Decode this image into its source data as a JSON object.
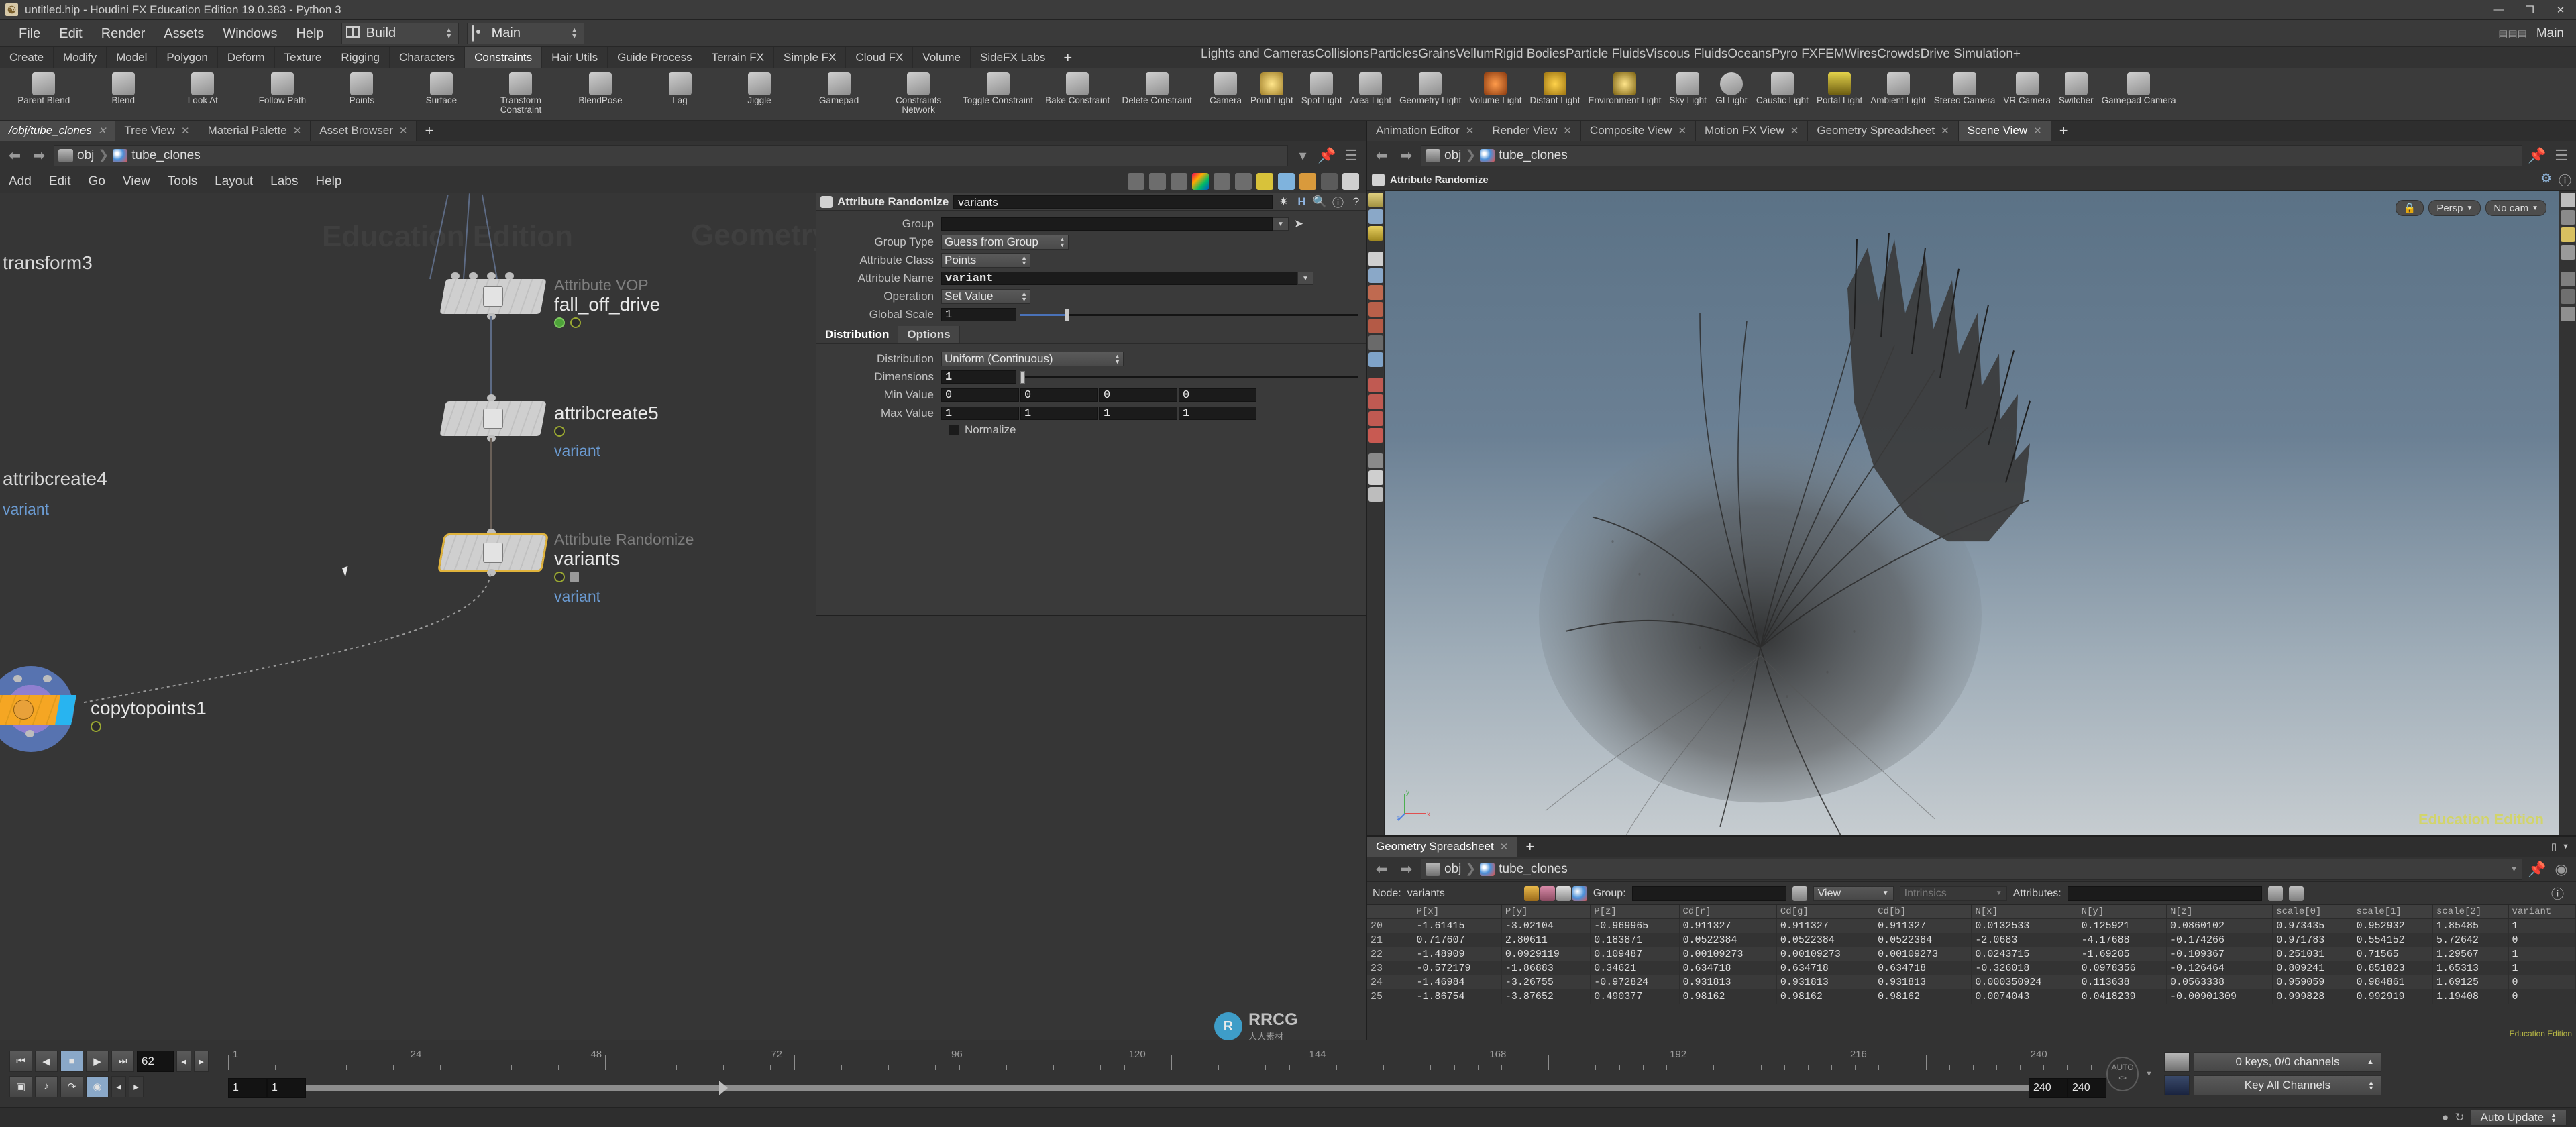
{
  "window": {
    "title": "untitled.hip - Houdini FX Education Edition 19.0.383 - Python 3",
    "minimize": "—",
    "maximize": "❐",
    "close": "✕"
  },
  "menubar": {
    "items": [
      "File",
      "Edit",
      "Render",
      "Assets",
      "Windows",
      "Help"
    ],
    "build_label": "Build",
    "desktop_label": "Main"
  },
  "shelf": {
    "left_tabs": [
      "Create",
      "Modify",
      "Model",
      "Polygon",
      "Deform",
      "Texture",
      "Rigging",
      "Characters",
      "Constraints",
      "Hair Utils",
      "Guide Process",
      "Terrain FX",
      "Simple FX",
      "Cloud FX",
      "Volume",
      "SideFX Labs"
    ],
    "left_active": "Constraints",
    "left_tools": [
      "Parent Blend",
      "Blend",
      "Look At",
      "Follow Path",
      "Points",
      "Surface",
      "Transform Constraint",
      "BlendPose",
      "Lag",
      "Jiggle",
      "Gamepad",
      "Constraints Network",
      "Toggle Constraint",
      "Bake Constraint",
      "Delete Constraint"
    ],
    "right_tabs": [
      "Lights and Cameras",
      "Collisions",
      "Particles",
      "Grains",
      "Vellum",
      "Rigid Bodies",
      "Particle Fluids",
      "Viscous Fluids",
      "Oceans",
      "Pyro FX",
      "FEM",
      "Wires",
      "Crowds",
      "Drive Simulation"
    ],
    "right_active": "Lights and Cameras",
    "right_tools": [
      "Camera",
      "Point Light",
      "Spot Light",
      "Area Light",
      "Geometry Light",
      "Volume Light",
      "Distant Light",
      "Environment Light",
      "Sky Light",
      "GI Light",
      "Caustic Light",
      "Portal Light",
      "Ambient Light",
      "Stereo Camera",
      "VR Camera",
      "Switcher",
      "Gamepad Camera"
    ],
    "plus": "+"
  },
  "network_pane": {
    "tabs": [
      {
        "label": "/obj/tube_clones",
        "active": true,
        "italic": true
      },
      {
        "label": "Tree View",
        "active": false,
        "italic": false
      },
      {
        "label": "Material Palette",
        "active": false,
        "italic": false
      },
      {
        "label": "Asset Browser",
        "active": false,
        "italic": false
      }
    ],
    "plus": "+",
    "path": [
      "obj",
      "tube_clones"
    ],
    "menu": [
      "Add",
      "Edit",
      "Go",
      "View",
      "Tools",
      "Layout",
      "Labs",
      "Help"
    ],
    "watermarks": [
      "Education Edition",
      "Geometry"
    ],
    "nodes": [
      {
        "name": "transform3",
        "type": "",
        "flags": [],
        "variant": ""
      },
      {
        "name": "attribcreate4",
        "type": "",
        "flags": [],
        "variant": "variant"
      },
      {
        "name": "fall_off_drive",
        "type": "Attribute VOP",
        "flags": [
          "display",
          "time"
        ],
        "variant": ""
      },
      {
        "name": "attribcreate5",
        "type": "",
        "flags": [
          "time"
        ],
        "variant": "variant"
      },
      {
        "name": "variants",
        "type": "Attribute Randomize",
        "flags": [
          "time",
          "lock"
        ],
        "variant": "variant",
        "selected": true
      },
      {
        "name": "copytopoints1",
        "type": "",
        "flags": [
          "time"
        ],
        "variant": ""
      }
    ]
  },
  "parameter_pane": {
    "node_type": "Attribute Randomize",
    "node_name": "variants",
    "header_icons": [
      "gear-icon",
      "houdini-icon",
      "search-icon",
      "info-icon",
      "help-icon"
    ],
    "params": [
      {
        "label": "Group",
        "value": "",
        "kind": "text-dropdown"
      },
      {
        "label": "Group Type",
        "value": "Guess from Group",
        "kind": "menu"
      },
      {
        "label": "Attribute Class",
        "value": "Points",
        "kind": "menu"
      },
      {
        "label": "Attribute Name",
        "value": "variant",
        "kind": "text-dropdown"
      },
      {
        "label": "Operation",
        "value": "Set Value",
        "kind": "menu"
      },
      {
        "label": "Global Scale",
        "value": "1",
        "kind": "slider"
      }
    ],
    "tabs": [
      {
        "label": "Distribution",
        "active": true
      },
      {
        "label": "Options",
        "active": false
      }
    ],
    "distribution": {
      "distribution_label": "Distribution",
      "distribution_value": "Uniform (Continuous)",
      "dimensions_label": "Dimensions",
      "dimensions_value": "1",
      "min_label": "Min Value",
      "min_values": [
        "0",
        "0",
        "0",
        "0"
      ],
      "max_label": "Max Value",
      "max_values": [
        "1",
        "1",
        "1",
        "1"
      ],
      "normalize_label": "Normalize",
      "normalize_checked": false
    }
  },
  "viewer_pane": {
    "tabs": [
      {
        "label": "Animation Editor",
        "active": false
      },
      {
        "label": "Render View",
        "active": false
      },
      {
        "label": "Composite View",
        "active": false
      },
      {
        "label": "Motion FX View",
        "active": false
      },
      {
        "label": "Geometry Spreadsheet",
        "active": false
      },
      {
        "label": "Scene View",
        "active": true
      }
    ],
    "plus": "+",
    "path": [
      "obj",
      "tube_clones"
    ],
    "viewer_title": "Attribute Randomize",
    "hud": {
      "lock": "🔒",
      "persp": "Persp",
      "cam": "No cam"
    },
    "watermark": "Education Edition",
    "axis": {
      "x": "x",
      "y": "y",
      "z": "z"
    }
  },
  "spreadsheet": {
    "tabs": [
      {
        "label": "Geometry Spreadsheet",
        "active": true
      }
    ],
    "plus": "+",
    "path": [
      "obj",
      "tube_clones"
    ],
    "node_label": "Node:",
    "node_value": "variants",
    "group_label": "Group:",
    "group_value": "",
    "view_label": "View",
    "intrinsics_label": "Intrinsics",
    "attributes_label": "Attributes:",
    "attributes_value": "",
    "columns": [
      "",
      "P[x]",
      "P[y]",
      "P[z]",
      "Cd[r]",
      "Cd[g]",
      "Cd[b]",
      "N[x]",
      "N[y]",
      "N[z]",
      "scale[0]",
      "scale[1]",
      "scale[2]",
      "variant"
    ],
    "rows": [
      [
        "20",
        "-1.61415",
        "-3.02104",
        "-0.969965",
        "0.911327",
        "0.911327",
        "0.911327",
        "0.0132533",
        "0.125921",
        "0.0860102",
        "0.973435",
        "0.952932",
        "1.85485",
        "1"
      ],
      [
        "21",
        "0.717607",
        "2.80611",
        "0.183871",
        "0.0522384",
        "0.0522384",
        "0.0522384",
        "-2.0683",
        "-4.17688",
        "-0.174266",
        "0.971783",
        "0.554152",
        "5.72642",
        "0"
      ],
      [
        "22",
        "-1.48909",
        "0.0929119",
        "0.109487",
        "0.00109273",
        "0.00109273",
        "0.00109273",
        "0.0243715",
        "-1.69205",
        "-0.109367",
        "0.251031",
        "0.71565",
        "1.29567",
        "1"
      ],
      [
        "23",
        "-0.572179",
        "-1.86883",
        "0.34621",
        "0.634718",
        "0.634718",
        "0.634718",
        "-0.326018",
        "0.0978356",
        "-0.126464",
        "0.809241",
        "0.851823",
        "1.65313",
        "1"
      ],
      [
        "24",
        "-1.46984",
        "-3.26755",
        "-0.972824",
        "0.931813",
        "0.931813",
        "0.931813",
        "0.000350924",
        "0.113638",
        "0.0563338",
        "0.959059",
        "0.984861",
        "1.69125",
        "0"
      ],
      [
        "25",
        "-1.86754",
        "-3.87652",
        "0.490377",
        "0.98162",
        "0.98162",
        "0.98162",
        "0.0074043",
        "0.0418239",
        "-0.00901309",
        "0.999828",
        "0.992919",
        "1.19408",
        "0"
      ]
    ],
    "edu_watermark": "Education Edition"
  },
  "playbar": {
    "current_frame": "62",
    "range_start": "1",
    "range_start2": "1",
    "range_end": "240",
    "range_end2": "240",
    "ticks": [
      "1",
      "24",
      "48",
      "72",
      "96",
      "120",
      "144",
      "168",
      "192",
      "216",
      "240"
    ],
    "keys_status": "0 keys, 0/0 channels",
    "key_mode": "Key All Channels",
    "auto_label": "AUTO",
    "transport": [
      "⏮",
      "◀",
      "■",
      "▶",
      "⏭"
    ]
  },
  "statusbar": {
    "auto_update": "Auto Update"
  },
  "brand": {
    "name": "RRCG",
    "sub": "人人素材",
    "mark": "R"
  },
  "colors": {
    "accent_blue": "#4a72b8",
    "selected_node": "#e0b33c",
    "variant_col": "#7a5f24",
    "edu_yellow": "#d8d84a",
    "node_text_blue": "#6b9bd2"
  }
}
